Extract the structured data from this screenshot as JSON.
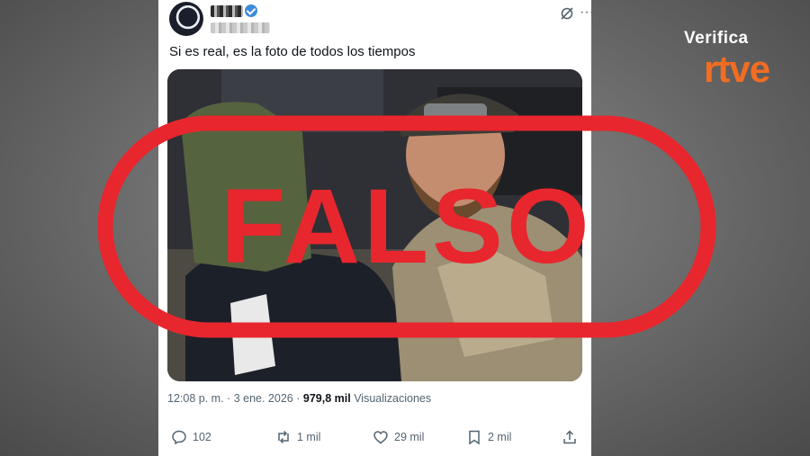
{
  "tweet": {
    "text": "Si es real, es la foto de todos los tiempos",
    "time": "12:08 p. m.",
    "separator": "·",
    "date": "3 ene. 2026",
    "views_count": "979,8 mil",
    "views_label": "Visualizaciones",
    "more_glyph": "···"
  },
  "actions": {
    "replies": "102",
    "reposts": "1 mil",
    "likes": "29 mil",
    "bookmarks": "2 mil"
  },
  "overlay": {
    "stamp_text": "FALSO",
    "stamp_color": "#e8262d"
  },
  "brand": {
    "verifica": "Verifica",
    "rtve": "rtve",
    "rtve_color": "#f26d21"
  },
  "icons": [
    "grok-icon",
    "more-icon",
    "reply-icon",
    "repost-icon",
    "like-icon",
    "bookmark-icon",
    "share-icon",
    "verified-icon"
  ]
}
